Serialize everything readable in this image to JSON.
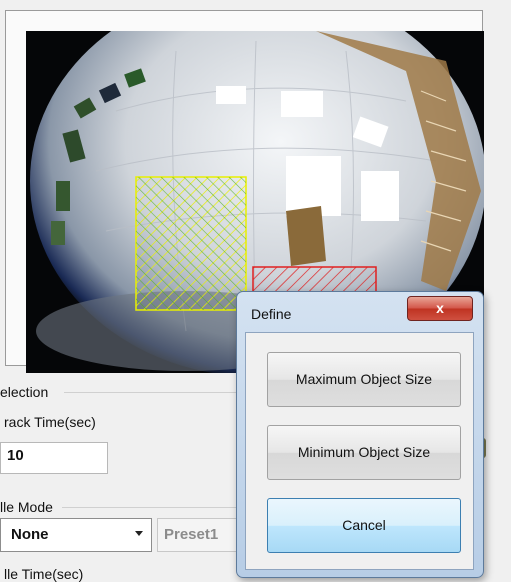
{
  "settings": {
    "selection_group_title": "election",
    "track_time_label": "rack Time(sec)",
    "track_time_value": "10",
    "idle_mode_group_title": "lle Mode",
    "idle_mode_selected": "None",
    "preset_value": "Preset1",
    "idle_time_label": "lle Time(sec)"
  },
  "dialog": {
    "title": "Define",
    "close_glyph": "x",
    "buttons": {
      "maximum": "Maximum Object Size",
      "minimum": "Minimum Object Size",
      "cancel": "Cancel"
    }
  },
  "zones": {
    "maximum_color": "#e8f000",
    "minimum_color": "#e02020"
  },
  "icons": {
    "combo_arrow": "chevron-down-icon",
    "close": "close-icon"
  }
}
